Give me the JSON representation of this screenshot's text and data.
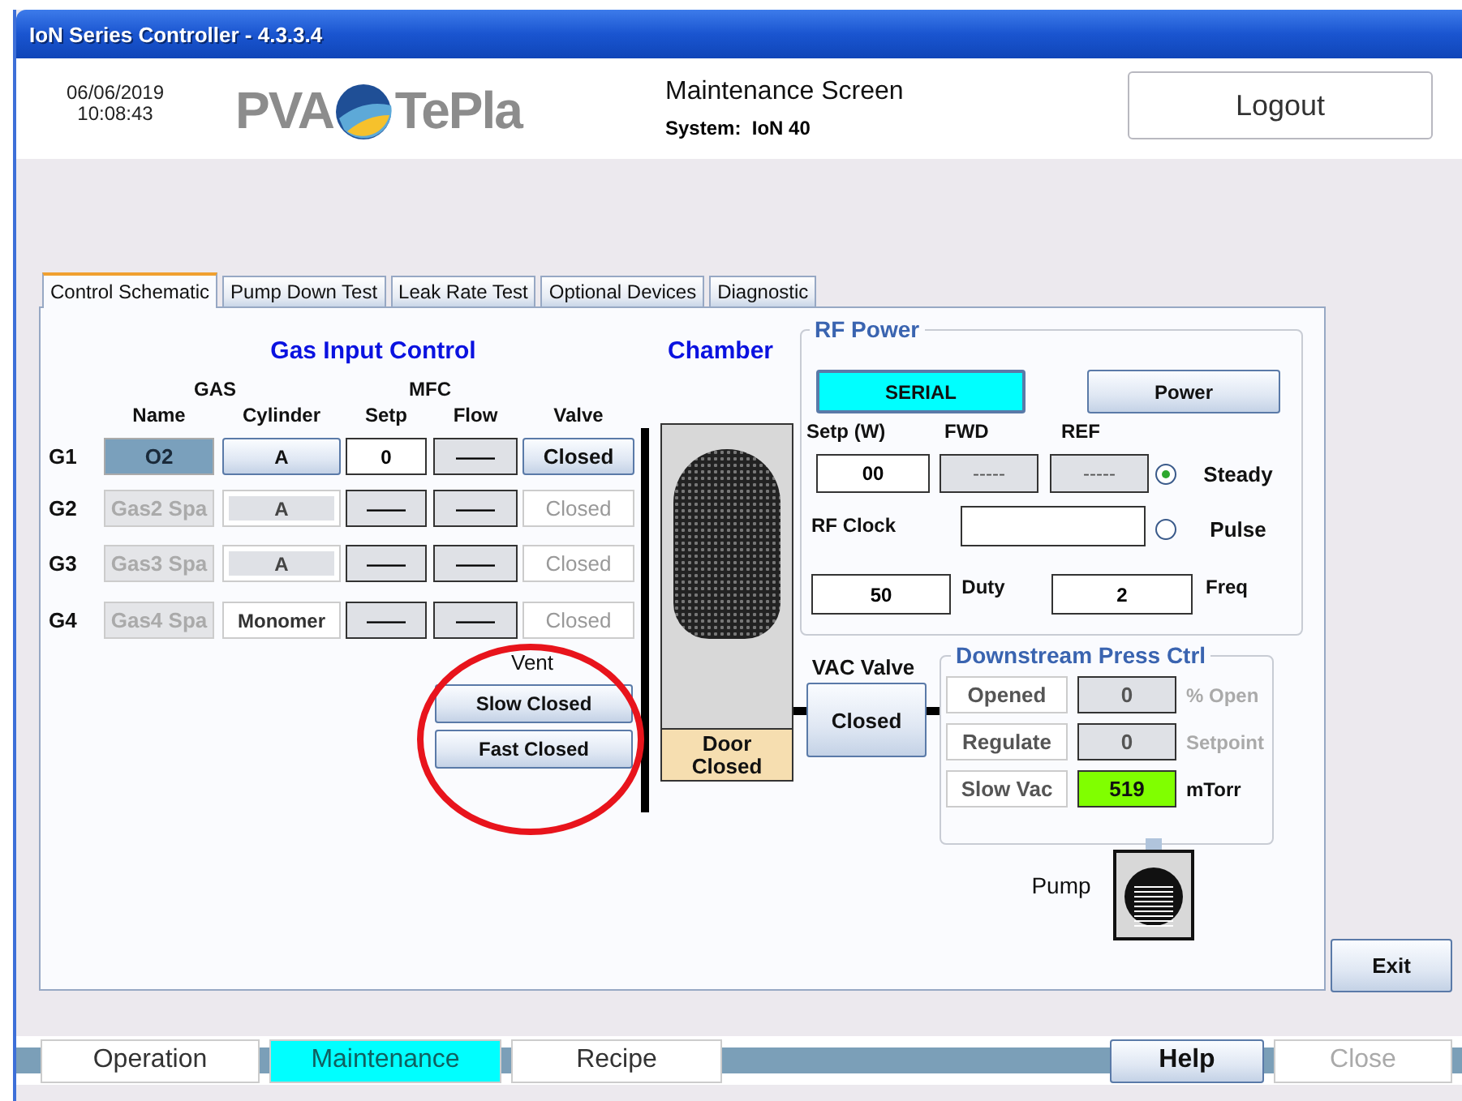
{
  "window": {
    "title": "IoN Series Controller - 4.3.3.4"
  },
  "header": {
    "date": "06/06/2019",
    "time": "10:08:43",
    "logo": [
      "PVA",
      "TePla"
    ],
    "screen_title": "Maintenance Screen",
    "system": "System:  IoN 40",
    "logout_button": "Logout"
  },
  "tabs": [
    {
      "label": "Control Schematic",
      "selected": true
    },
    {
      "label": "Pump Down Test",
      "selected": false
    },
    {
      "label": "Leak Rate Test",
      "selected": false
    },
    {
      "label": "Optional Devices",
      "selected": false
    },
    {
      "label": "Diagnostic",
      "selected": false
    }
  ],
  "gas_control": {
    "title": "Gas Input Control",
    "group_headers": [
      "GAS",
      "MFC"
    ],
    "columns": [
      "Name",
      "Cylinder",
      "Setp",
      "Flow",
      "Valve"
    ],
    "rows": [
      {
        "label": "G1",
        "name": "O2",
        "cylinder": "A",
        "setp": "0",
        "flow": "——",
        "valve": "Closed",
        "disabled": false,
        "cylinder_disabled": false
      },
      {
        "label": "G2",
        "name": "Gas2 Spa",
        "cylinder": "A",
        "setp": "——",
        "flow": "——",
        "valve": "Closed",
        "disabled": true,
        "cylinder_disabled": true
      },
      {
        "label": "G3",
        "name": "Gas3 Spa",
        "cylinder": "A",
        "setp": "——",
        "flow": "——",
        "valve": "Closed",
        "disabled": true,
        "cylinder_disabled": true
      },
      {
        "label": "G4",
        "name": "Gas4 Spa",
        "cylinder": "Monomer",
        "setp": "——",
        "flow": "——",
        "valve": "Closed",
        "disabled": true,
        "cylinder_disabled": false
      }
    ]
  },
  "chamber": {
    "title": "Chamber",
    "door": "Door Closed"
  },
  "vent": {
    "label": "Vent",
    "buttons": [
      "Slow Closed",
      "Fast Closed"
    ]
  },
  "rf_power": {
    "title": "RF Power",
    "mode": "SERIAL",
    "power_button": "Power",
    "headers": [
      "Setp (W)",
      "FWD",
      "REF"
    ],
    "setpoint": "00",
    "fwd": "-----",
    "ref": "-----",
    "pulse_modes": [
      {
        "label": "Steady",
        "selected": true
      },
      {
        "label": "Pulse",
        "selected": false
      }
    ],
    "clock_label": "RF Clock",
    "duty": "50",
    "duty_label": "Duty",
    "freq": "2",
    "freq_label": "Freq"
  },
  "vac_valve": {
    "label": "VAC Valve",
    "state": "Closed"
  },
  "downstream": {
    "title": "Downstream Press Ctrl",
    "rows": [
      {
        "button": "Opened",
        "value": "0",
        "unit": "% Open",
        "active": false
      },
      {
        "button": "Regulate",
        "value": "0",
        "unit": "Setpoint",
        "active": false
      },
      {
        "button": "Slow Vac",
        "value": "519",
        "unit": "mTorr",
        "active": true
      }
    ]
  },
  "pump": {
    "label": "Pump"
  },
  "exit_button": "Exit",
  "nav": [
    {
      "label": "Operation",
      "kind": "tab",
      "selected": false,
      "disabled": false
    },
    {
      "label": "Maintenance",
      "kind": "tab",
      "selected": true,
      "disabled": false
    },
    {
      "label": "Recipe",
      "kind": "tab",
      "selected": false,
      "disabled": false
    },
    {
      "label": "Help",
      "kind": "button",
      "selected": false,
      "disabled": false
    },
    {
      "label": "Close",
      "kind": "tab",
      "selected": false,
      "disabled": true
    }
  ]
}
